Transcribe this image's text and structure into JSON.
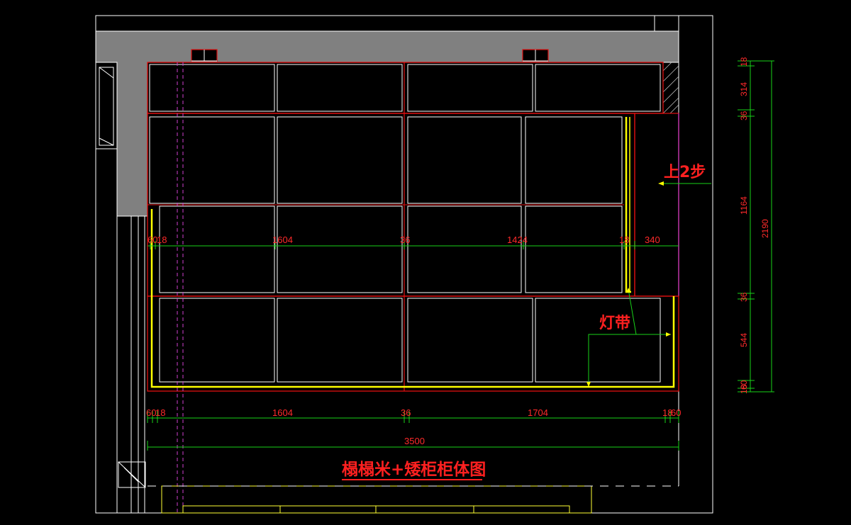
{
  "labels": {
    "step_note": "上2步",
    "light_strip": "灯带",
    "title": "榻榻米+矮柜柜体图"
  },
  "dimensions": {
    "row1": [
      "60",
      "18",
      "1604",
      "36",
      "1424",
      "18",
      "340"
    ],
    "row2": [
      "60",
      "18",
      "1604",
      "36",
      "1704",
      "18",
      "60"
    ],
    "overall_width": "3500",
    "vertical": [
      "18",
      "314",
      "36",
      "1164",
      "36",
      "544",
      "60",
      "18"
    ],
    "overall_height": "2190"
  },
  "colors": {
    "background": "#000000",
    "wall_fill": "#808080",
    "outline_white": "#ffffff",
    "panel_red": "#e01010",
    "dimension_green": "#19d219",
    "dimension_text": "#ff2a2a",
    "light_strip_yellow": "#ffff00",
    "dash_magenta": "#d040d0",
    "label_red": "#ff2020"
  }
}
